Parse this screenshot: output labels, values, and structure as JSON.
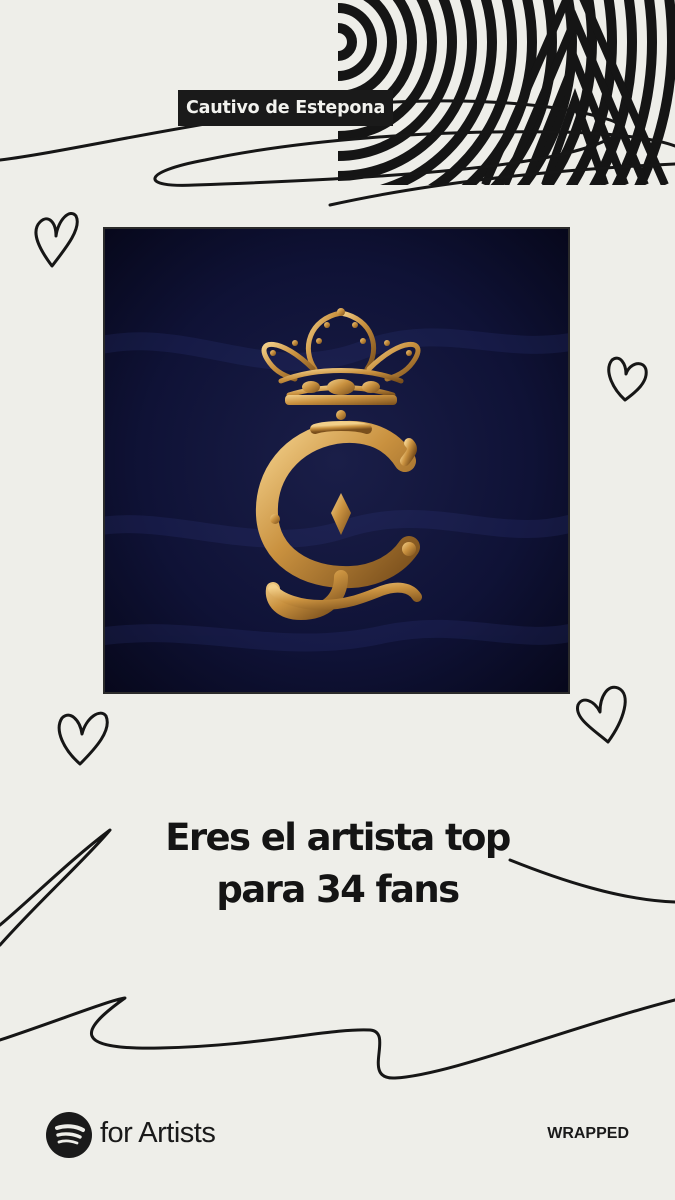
{
  "artist_name": "Cautivo de Estepona",
  "headline": {
    "line1": "Eres el artista top",
    "line2": "para 34 fans"
  },
  "footer": {
    "brand": "for Artists",
    "wrapped": "WRAPPED"
  },
  "icons": [
    "spotify-logo-icon",
    "heart-doodle-icon",
    "scribble-line-doodle",
    "op-art-stripes-pattern",
    "crown-monogram-emblem"
  ],
  "colors": {
    "background": "#eeeee9",
    "ink": "#141414",
    "artwork_background": "#0d1030",
    "emblem_gold": "#c9913f"
  }
}
